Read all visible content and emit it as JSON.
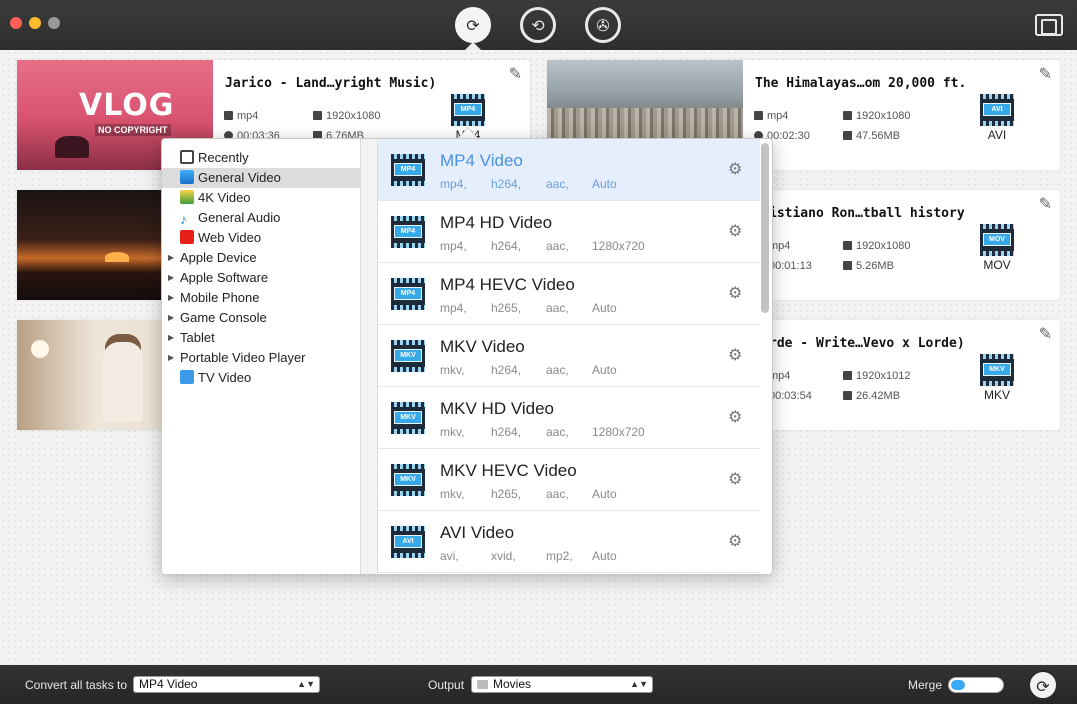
{
  "toolbar": {
    "icons": [
      "convert-icon",
      "compress-icon",
      "media-icon"
    ],
    "media_browser_icon": "film-folder-icon"
  },
  "tasks": [
    {
      "title": "Jarico - Land…yright Music)",
      "format": "mp4",
      "resolution": "1920x1080",
      "duration": "00:03:36",
      "size": "6.76MB",
      "target": "MP4",
      "thumb_text": "VLOG",
      "thumb_subtext": "NO COPYRIGHT"
    },
    {
      "title": "The Himalayas…om 20,000 ft.",
      "format": "mp4",
      "resolution": "1920x1080",
      "duration": "00:02:30",
      "size": "47.56MB",
      "target": "AVI"
    },
    {
      "title": "istiano Ron…tball history",
      "format": "mp4",
      "resolution": "1920x1080",
      "duration": "00:01:13",
      "size": "5.26MB",
      "target": "MOV"
    },
    {
      "title": "rde - Write…Vevo x Lorde)",
      "format": "mp4",
      "resolution": "1920x1012",
      "duration": "00:03:54",
      "size": "26.42MB",
      "target": "MKV"
    }
  ],
  "categories": [
    {
      "label": "Recently",
      "icon": "recent-icon",
      "expandable": false
    },
    {
      "label": "General Video",
      "icon": "general-video-icon",
      "expandable": false,
      "selected": true
    },
    {
      "label": "4K Video",
      "icon": "4k-video-icon",
      "expandable": false
    },
    {
      "label": "General Audio",
      "icon": "audio-note-icon",
      "expandable": false
    },
    {
      "label": "Web Video",
      "icon": "youtube-icon",
      "expandable": false
    },
    {
      "label": "Apple Device",
      "expandable": true
    },
    {
      "label": "Apple Software",
      "expandable": true
    },
    {
      "label": "Mobile Phone",
      "expandable": true
    },
    {
      "label": "Game Console",
      "expandable": true
    },
    {
      "label": "Tablet",
      "expandable": true
    },
    {
      "label": "Portable Video Player",
      "expandable": true
    },
    {
      "label": "TV Video",
      "icon": "tv-icon",
      "expandable": false
    }
  ],
  "presets": [
    {
      "name": "MP4 Video",
      "badge": "MP4",
      "specs": [
        "mp4,",
        "h264,",
        "aac,",
        "Auto"
      ],
      "selected": true
    },
    {
      "name": "MP4 HD Video",
      "badge": "MP4",
      "specs": [
        "mp4,",
        "h264,",
        "aac,",
        "1280x720"
      ]
    },
    {
      "name": "MP4 HEVC Video",
      "badge": "MP4",
      "specs": [
        "mp4,",
        "h265,",
        "aac,",
        "Auto"
      ]
    },
    {
      "name": "MKV Video",
      "badge": "MKV",
      "specs": [
        "mkv,",
        "h264,",
        "aac,",
        "Auto"
      ]
    },
    {
      "name": "MKV HD Video",
      "badge": "MKV",
      "specs": [
        "mkv,",
        "h264,",
        "aac,",
        "1280x720"
      ]
    },
    {
      "name": "MKV HEVC Video",
      "badge": "MKV",
      "specs": [
        "mkv,",
        "h265,",
        "aac,",
        "Auto"
      ]
    },
    {
      "name": "AVI Video",
      "badge": "AVI",
      "specs": [
        "avi,",
        "xvid,",
        "mp2,",
        "Auto"
      ]
    }
  ],
  "bottom": {
    "convert_label": "Convert all tasks to",
    "convert_value": "MP4 Video",
    "output_label": "Output",
    "output_value": "Movies",
    "merge_label": "Merge",
    "merge_on": false
  },
  "colors": {
    "accent": "#4a90e2",
    "toggle": "#3aa9f5",
    "close": "#fe5f57",
    "minimize": "#febc2e"
  }
}
